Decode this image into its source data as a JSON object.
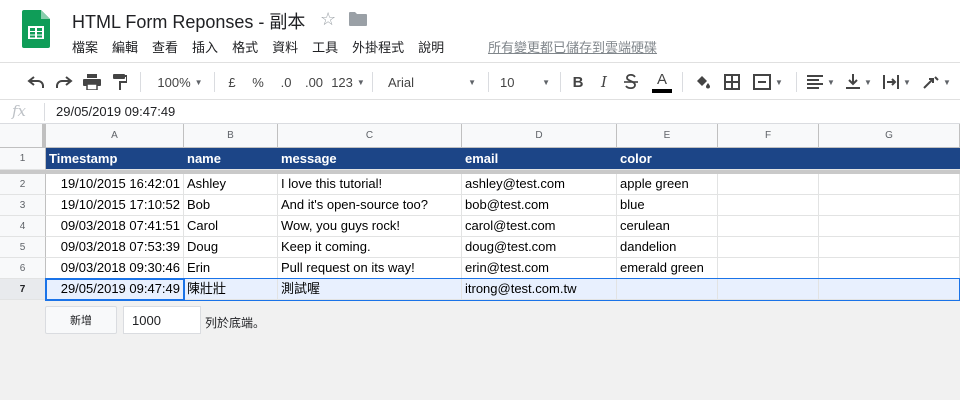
{
  "doc": {
    "title": "HTML Form Reponses - 副本",
    "saved_status": "所有變更都已儲存到雲端硬碟"
  },
  "menu": [
    "檔案",
    "編輯",
    "查看",
    "插入",
    "格式",
    "資料",
    "工具",
    "外掛程式",
    "說明"
  ],
  "toolbar": {
    "zoom": "100%",
    "currency": "£",
    "percent": "%",
    "decrease_decimal": ".0",
    "increase_decimal": ".00",
    "more_formats": "123",
    "font": "Arial",
    "font_size": "10",
    "bold": "B",
    "italic": "I",
    "text_color_letter": "A"
  },
  "formula_bar": {
    "fx": "fx",
    "value": "29/05/2019 09:47:49"
  },
  "sheet": {
    "columns": [
      "A",
      "B",
      "C",
      "D",
      "E",
      "F",
      "G"
    ],
    "row_numbers": [
      "1",
      "2",
      "3",
      "4",
      "5",
      "6",
      "7"
    ],
    "header": [
      "Timestamp",
      "name",
      "message",
      "email",
      "color"
    ],
    "rows": [
      [
        "19/10/2015 16:42:01",
        "Ashley",
        "I love this tutorial!",
        "ashley@test.com",
        "apple green"
      ],
      [
        "19/10/2015 17:10:52",
        "Bob",
        "And it's open-source too?",
        "bob@test.com",
        "blue"
      ],
      [
        "09/03/2018 07:41:51",
        "Carol",
        "Wow, you guys rock!",
        "carol@test.com",
        "cerulean"
      ],
      [
        "09/03/2018 07:53:39",
        "Doug",
        "Keep it coming.",
        "doug@test.com",
        "dandelion"
      ],
      [
        "09/03/2018 09:30:46",
        "Erin",
        "Pull request on its way!",
        "erin@test.com",
        "emerald green"
      ],
      [
        "29/05/2019 09:47:49",
        "陳壯壯",
        "測試喔",
        "itrong@test.com.tw",
        ""
      ]
    ],
    "active_row": 7,
    "active_cell": "A7"
  },
  "add_rows": {
    "button_label": "新增",
    "count": "1000",
    "suffix": "列於底端。"
  },
  "colors": {
    "header_bg": "#1c4587",
    "header_text": "#ffffff",
    "selection_bg": "#e8f0fe",
    "selection_border": "#1a73e8",
    "sheets_green": "#0f9d58"
  }
}
